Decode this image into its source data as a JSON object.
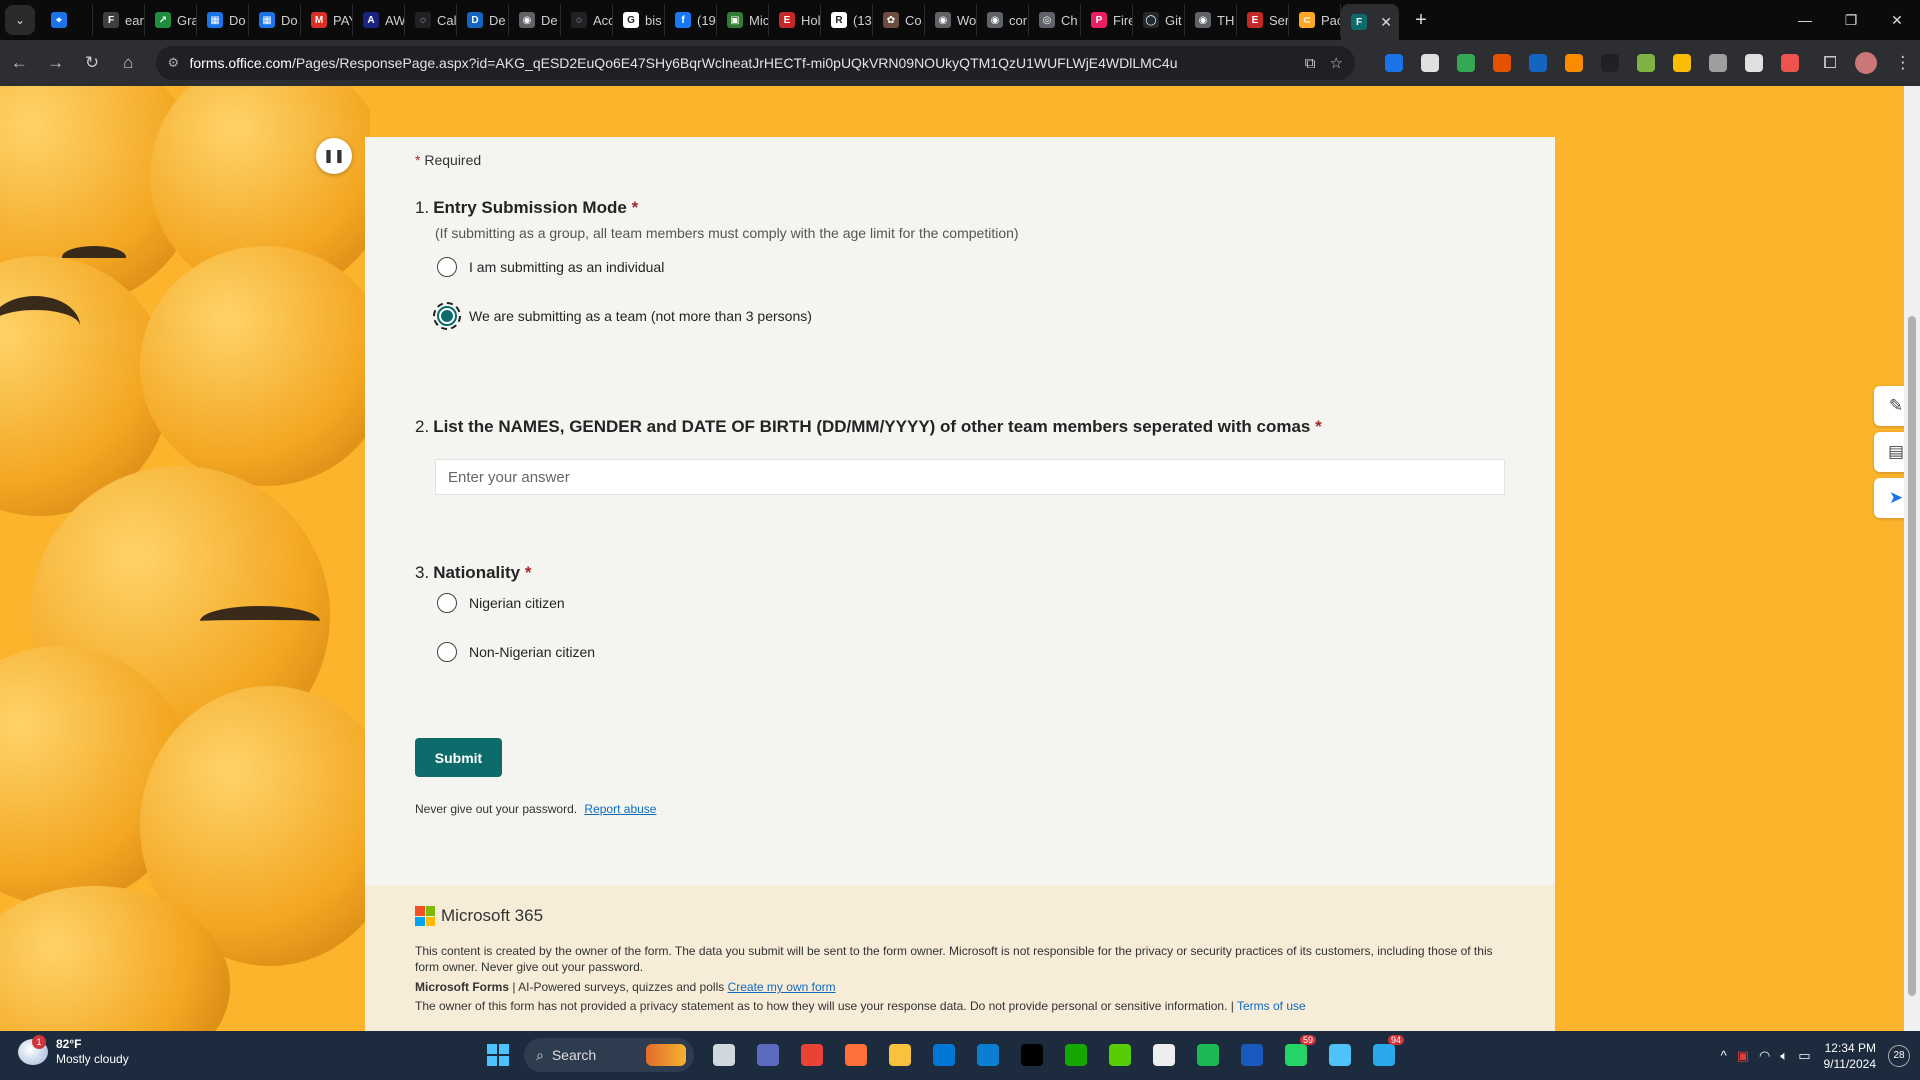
{
  "browser": {
    "tabs": [
      {
        "label": "",
        "color": "#1a73e8",
        "glyph": "⌖"
      },
      {
        "label": "ear",
        "color": "#3c4043",
        "glyph": "F"
      },
      {
        "label": "Gra",
        "color": "#1e8e3e",
        "glyph": "↗"
      },
      {
        "label": "Do",
        "color": "#1a73e8",
        "glyph": "▦"
      },
      {
        "label": "Do",
        "color": "#1a73e8",
        "glyph": "▦"
      },
      {
        "label": "PAY",
        "color": "#d93025",
        "glyph": "M"
      },
      {
        "label": "AW",
        "color": "#1a237e",
        "glyph": "A"
      },
      {
        "label": "Cal",
        "color": "#202124",
        "glyph": "◌"
      },
      {
        "label": "De",
        "color": "#1565c0",
        "glyph": "D"
      },
      {
        "label": "De",
        "color": "#5f6368",
        "glyph": "◉"
      },
      {
        "label": "Acc",
        "color": "#202124",
        "glyph": "◌"
      },
      {
        "label": "bis",
        "color": "#ffffff",
        "glyph": "G"
      },
      {
        "label": "(19",
        "color": "#1877f2",
        "glyph": "f"
      },
      {
        "label": "Mic",
        "color": "#2e7d32",
        "glyph": "▣"
      },
      {
        "label": "Hol",
        "color": "#c62828",
        "glyph": "E"
      },
      {
        "label": "(13",
        "color": "#ffffff",
        "glyph": "R"
      },
      {
        "label": "Co",
        "color": "#6d4c41",
        "glyph": "✿"
      },
      {
        "label": "Wo",
        "color": "#5f6368",
        "glyph": "◉"
      },
      {
        "label": "cor",
        "color": "#5f6368",
        "glyph": "◉"
      },
      {
        "label": "Ch",
        "color": "#5f6368",
        "glyph": "◎"
      },
      {
        "label": "Fire",
        "color": "#e91e63",
        "glyph": "P"
      },
      {
        "label": "Git",
        "color": "#24292f",
        "glyph": "◯"
      },
      {
        "label": "TH",
        "color": "#5f6368",
        "glyph": "◉"
      },
      {
        "label": "Ser",
        "color": "#c62828",
        "glyph": "E"
      },
      {
        "label": "Pac",
        "color": "#f9a825",
        "glyph": "⊂"
      }
    ],
    "active_tab": {
      "label": "",
      "color": "#0e6b6b",
      "glyph": "F"
    },
    "new_tab_label": "+",
    "url_domain": "forms.office.com",
    "url_path": "/Pages/ResponsePage.aspx?id=AKG_qESD2EuQo6E47SHy6BqrWclneatJrHECTf-mi0pUQkVRN09NOUkyQTM1QzU1WUFLWjE4WDlLMC4u",
    "extensions": [
      "#1a73e8",
      "#e0e0e0",
      "#34a853",
      "#e65100",
      "#1565c0",
      "#fb8c00",
      "#202124",
      "#7cb342",
      "#fbbc04",
      "#9e9e9e",
      "#e0e0e0",
      "#ef5350"
    ]
  },
  "form": {
    "required_label": "Required",
    "questions": [
      {
        "number": "1.",
        "title": "Entry Submission Mode",
        "subtitle": "(If submitting as a group, all team members must comply with the age limit for the competition)",
        "options": [
          "I am submitting as an individual",
          "We are submitting as a team (not more than 3 persons)"
        ],
        "selected": 1
      },
      {
        "number": "2.",
        "title": "List the NAMES, GENDER and DATE OF BIRTH (DD/MM/YYYY) of other team members seperated with comas",
        "placeholder": "Enter your answer",
        "value": ""
      },
      {
        "number": "3.",
        "title": "Nationality",
        "options": [
          "Nigerian citizen",
          "Non-Nigerian citizen"
        ],
        "selected": null
      }
    ],
    "submit_label": "Submit",
    "password_note": "Never give out your password.",
    "report_link": "Report abuse",
    "footer": {
      "brand": "Microsoft 365",
      "disclaimer": "This content is created by the owner of the form. The data you submit will be sent to the form owner. Microsoft is not responsible for the privacy or security practices of its customers, including those of this form owner. Never give out your password.",
      "forms_name": "Microsoft Forms",
      "forms_tagline": " | AI-Powered surveys, quizzes and polls ",
      "create_link": "Create my own form",
      "privacy_note": "The owner of this form has not provided a privacy statement as to how they will use your response data. Do not provide personal or sensitive information. | ",
      "terms_link": "Terms of use"
    },
    "accent_color": "#0e6b6b",
    "background_color": "#fbb42c"
  },
  "taskbar": {
    "weather_temp": "82°F",
    "weather_desc": "Mostly cloudy",
    "weather_badge": "1",
    "search_label": "Search",
    "apps": [
      {
        "name": "task-view",
        "color": "#cfd8dc"
      },
      {
        "name": "meet",
        "color": "#5c6bc0"
      },
      {
        "name": "chrome",
        "color": "#ea4335"
      },
      {
        "name": "firefox",
        "color": "#ff7139"
      },
      {
        "name": "file-explorer",
        "color": "#f9c23c"
      },
      {
        "name": "store",
        "color": "#0078d4"
      },
      {
        "name": "vscode",
        "color": "#0a7fd1"
      },
      {
        "name": "x",
        "color": "#000000"
      },
      {
        "name": "upwork",
        "color": "#14a800"
      },
      {
        "name": "duolingo",
        "color": "#58cc02"
      },
      {
        "name": "chart-app",
        "color": "#eeeeee"
      },
      {
        "name": "spotify",
        "color": "#1db954"
      },
      {
        "name": "word",
        "color": "#185abd"
      },
      {
        "name": "whatsapp",
        "color": "#25d366",
        "count": "59"
      },
      {
        "name": "notepad",
        "color": "#4fc3f7"
      },
      {
        "name": "telegram",
        "color": "#29a9eb",
        "count": "94"
      }
    ],
    "time": "12:34 PM",
    "date": "9/11/2024",
    "notification_count": "28"
  }
}
